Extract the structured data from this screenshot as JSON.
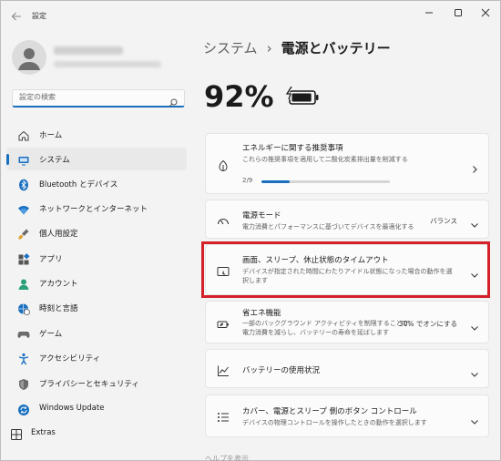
{
  "window": {
    "app_title": "設定"
  },
  "search": {
    "placeholder": "設定の検索"
  },
  "sidebar": {
    "items": [
      {
        "label": "ホーム",
        "icon": "home-icon"
      },
      {
        "label": "システム",
        "icon": "system-icon",
        "active": true
      },
      {
        "label": "Bluetooth とデバイス",
        "icon": "bluetooth-icon"
      },
      {
        "label": "ネットワークとインターネット",
        "icon": "wifi-icon"
      },
      {
        "label": "個人用設定",
        "icon": "brush-icon"
      },
      {
        "label": "アプリ",
        "icon": "apps-icon"
      },
      {
        "label": "アカウント",
        "icon": "account-icon"
      },
      {
        "label": "時刻と言語",
        "icon": "globe-clock-icon"
      },
      {
        "label": "ゲーム",
        "icon": "gamepad-icon"
      },
      {
        "label": "アクセシビリティ",
        "icon": "accessibility-icon"
      },
      {
        "label": "プライバシーとセキュリティ",
        "icon": "shield-icon"
      },
      {
        "label": "Windows Update",
        "icon": "update-icon"
      },
      {
        "label": "Extras",
        "icon": "extras-icon"
      }
    ]
  },
  "header": {
    "parent": "システム",
    "separator": "›",
    "current": "電源とバッテリー"
  },
  "battery": {
    "percent": "92%",
    "level": 0.92
  },
  "cards": {
    "energy": {
      "title": "エネルギーに関する推奨事項",
      "desc": "これらの推奨事項を適用して二酸化炭素排出量を削減する",
      "progress_label": "2/9",
      "progress": 0.222
    },
    "power_mode": {
      "title": "電源モード",
      "desc": "電力消費とパフォーマンスに基づいてデバイスを最適化する",
      "value": "バランス"
    },
    "screen_sleep": {
      "title": "画面、スリープ、休止状態のタイムアウト",
      "desc": "デバイスが指定された時間にわたりアイドル状態になった場合の動作を選択します"
    },
    "saver": {
      "title": "省エネ機能",
      "desc": "一部のバックグラウンド アクティビティを制限することで、電力消費を減らし、バッテリーの寿命を延ばします",
      "value": "30% でオンにする"
    },
    "usage": {
      "title": "バッテリーの使用状況"
    },
    "lid": {
      "title": "カバー、電源とスリープ 側のボタン コントロール",
      "desc": "デバイスの物理コントロールを操作したときの動作を選択します"
    }
  },
  "footer_partial": "ヘルプを表示",
  "colors": {
    "accent": "#1a6fbf",
    "highlight": "#d32029"
  }
}
